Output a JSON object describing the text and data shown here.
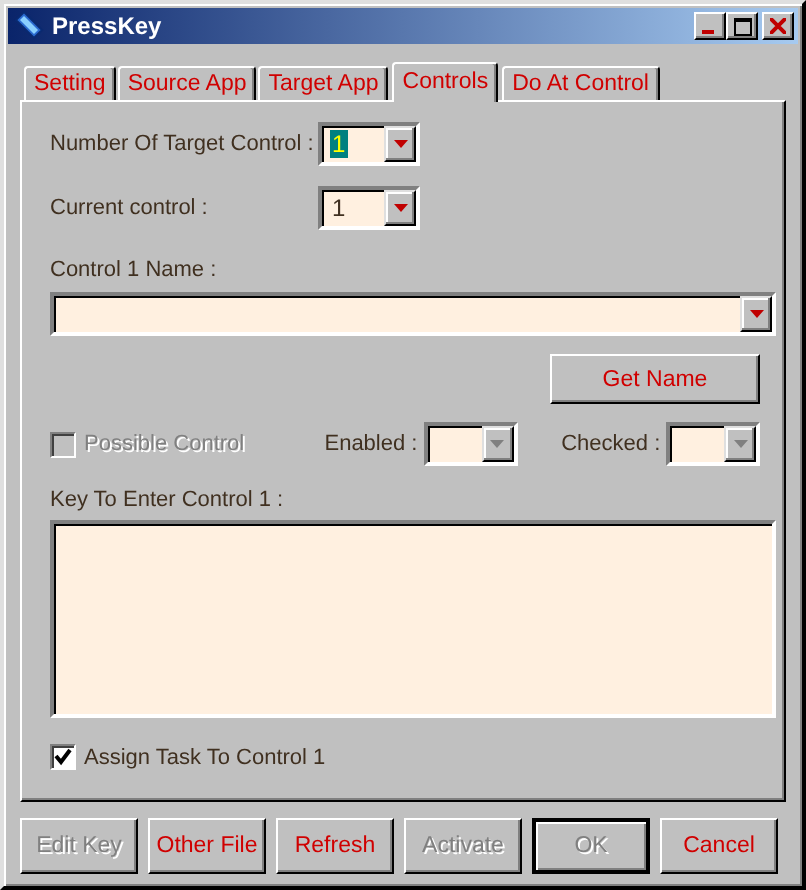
{
  "window": {
    "title": "PressKey"
  },
  "tabs": [
    {
      "label": "Setting",
      "selected": false
    },
    {
      "label": "Source App",
      "selected": false
    },
    {
      "label": "Target App",
      "selected": false
    },
    {
      "label": "Controls",
      "selected": true
    },
    {
      "label": "Do At Control",
      "selected": false
    }
  ],
  "number_of_target_control": {
    "label": "Number Of Target Control :",
    "value": "1",
    "highlighted": true
  },
  "current_control": {
    "label": "Current control :",
    "value": "1",
    "highlighted": false
  },
  "control_name": {
    "label": "Control 1 Name :"
  },
  "get_name_button": {
    "label": "Get Name"
  },
  "possible_control": {
    "label": "Possible Control",
    "checked": false,
    "disabled": true
  },
  "enabled": {
    "label": "Enabled :",
    "disabled": true
  },
  "checked": {
    "label": "Checked :",
    "disabled": true
  },
  "key_to_enter": {
    "label": "Key To Enter Control 1 :"
  },
  "assign_task": {
    "label": "Assign Task To Control 1",
    "checked": true,
    "disabled": false
  },
  "buttons": [
    {
      "label": "Edit Key",
      "disabled": true,
      "default": false
    },
    {
      "label": "Other File",
      "disabled": false,
      "default": false
    },
    {
      "label": "Refresh",
      "disabled": false,
      "default": false
    },
    {
      "label": "Activate",
      "disabled": true,
      "default": false
    },
    {
      "label": "OK",
      "disabled": true,
      "default": true
    },
    {
      "label": "Cancel",
      "disabled": false,
      "default": false
    }
  ]
}
